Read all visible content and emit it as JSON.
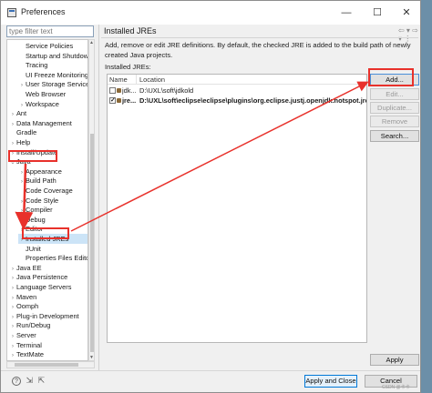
{
  "window": {
    "title": "Preferences"
  },
  "title_buttons": {
    "minimize": "—",
    "maximize": "☐",
    "close": "✕"
  },
  "filter": {
    "placeholder": "type filter text"
  },
  "tree": [
    {
      "label": "Service Policies",
      "depth": 2,
      "chevron": ""
    },
    {
      "label": "Startup and Shutdown",
      "depth": 2,
      "chevron": ""
    },
    {
      "label": "Tracing",
      "depth": 2,
      "chevron": ""
    },
    {
      "label": "UI Freeze Monitoring",
      "depth": 2,
      "chevron": ""
    },
    {
      "label": "User Storage Service",
      "depth": 2,
      "chevron": "›"
    },
    {
      "label": "Web Browser",
      "depth": 2,
      "chevron": ""
    },
    {
      "label": "Workspace",
      "depth": 2,
      "chevron": "›"
    },
    {
      "label": "Ant",
      "depth": 1,
      "chevron": "›"
    },
    {
      "label": "Data Management",
      "depth": 1,
      "chevron": "›"
    },
    {
      "label": "Gradle",
      "depth": 1,
      "chevron": ""
    },
    {
      "label": "Help",
      "depth": 1,
      "chevron": "›"
    },
    {
      "label": "Install/Update",
      "depth": 1,
      "chevron": "›"
    },
    {
      "label": "Java",
      "depth": 1,
      "chevron": "⌄"
    },
    {
      "label": "Appearance",
      "depth": 2,
      "chevron": "›"
    },
    {
      "label": "Build Path",
      "depth": 2,
      "chevron": "›"
    },
    {
      "label": "Code Coverage",
      "depth": 2,
      "chevron": ""
    },
    {
      "label": "Code Style",
      "depth": 2,
      "chevron": "›"
    },
    {
      "label": "Compiler",
      "depth": 2,
      "chevron": "›"
    },
    {
      "label": "Debug",
      "depth": 2,
      "chevron": "›"
    },
    {
      "label": "Editor",
      "depth": 2,
      "chevron": "›"
    },
    {
      "label": "Installed JREs",
      "depth": 2,
      "chevron": "›",
      "selected": true
    },
    {
      "label": "JUnit",
      "depth": 2,
      "chevron": ""
    },
    {
      "label": "Properties Files Editor",
      "depth": 2,
      "chevron": ""
    },
    {
      "label": "Java EE",
      "depth": 1,
      "chevron": "›"
    },
    {
      "label": "Java Persistence",
      "depth": 1,
      "chevron": "›"
    },
    {
      "label": "Language Servers",
      "depth": 1,
      "chevron": "›"
    },
    {
      "label": "Maven",
      "depth": 1,
      "chevron": "›"
    },
    {
      "label": "Oomph",
      "depth": 1,
      "chevron": "›"
    },
    {
      "label": "Plug-in Development",
      "depth": 1,
      "chevron": "›"
    },
    {
      "label": "Run/Debug",
      "depth": 1,
      "chevron": "›"
    },
    {
      "label": "Server",
      "depth": 1,
      "chevron": "›"
    },
    {
      "label": "Terminal",
      "depth": 1,
      "chevron": "›"
    },
    {
      "label": "TextMate",
      "depth": 1,
      "chevron": "›"
    }
  ],
  "page": {
    "title": "Installed JREs",
    "nav_arrows": "⇦ ▾ ⇨ ▾ ⋮",
    "description": "Add, remove or edit JRE definitions. By default, the checked JRE is added to the build path of newly created Java projects.",
    "jres_label": "Installed JREs:",
    "columns": {
      "name": "Name",
      "location": "Location"
    },
    "rows": [
      {
        "name": "jdk...",
        "location": "D:\\UXL\\soft\\jdkold",
        "checked": false
      },
      {
        "name": "jre...",
        "location": "D:\\UXL\\soft\\eclipse\\eclipse\\plugins\\org.eclipse.justj.openjdk.hotspot.jre",
        "checked": true
      }
    ]
  },
  "buttons": {
    "add": "Add...",
    "edit": "Edit...",
    "duplicate": "Duplicate...",
    "remove": "Remove",
    "search": "Search...",
    "apply": "Apply",
    "apply_close": "Apply and Close",
    "cancel": "Cancel"
  },
  "footer_icons": [
    "help-icon",
    "import-icon",
    "export-icon"
  ],
  "watermark": "CSDN @卡卡",
  "annotation_color": "#e8312b"
}
